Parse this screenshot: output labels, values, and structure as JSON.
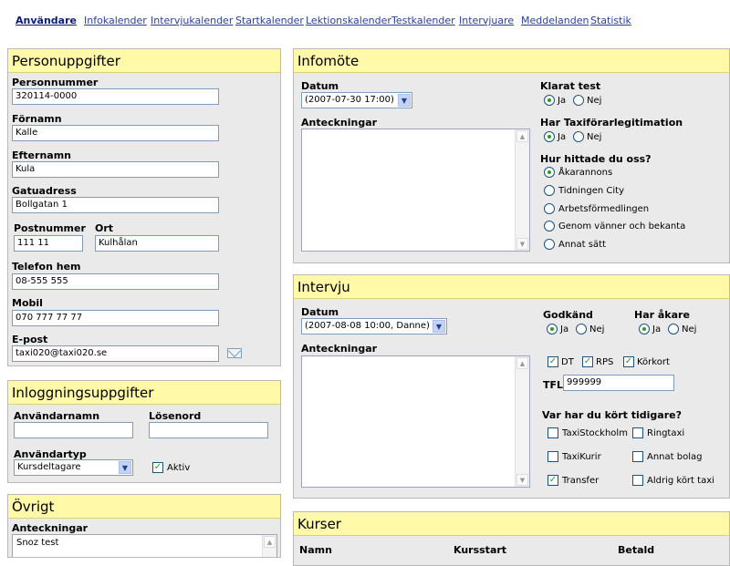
{
  "nav": [
    {
      "label": "Användare"
    },
    {
      "label": "Infokalender"
    },
    {
      "label": "Intervjukalender"
    },
    {
      "label": "Startkalender"
    },
    {
      "label": "Lektionskalender"
    },
    {
      "label": "Testkalender"
    },
    {
      "label": "Intervjuare"
    },
    {
      "label": "Meddelanden"
    },
    {
      "label": "Statistik"
    }
  ],
  "person": {
    "title": "Personuppgifter",
    "personnummer_label": "Personnummer",
    "personnummer": "320114-0000",
    "fornamn_label": "Förnamn",
    "fornamn": "Kalle",
    "efternamn_label": "Efternamn",
    "efternamn": "Kula",
    "gatuadress_label": "Gatuadress",
    "gatuadress": "Bollgatan 1",
    "postnummer_label": "Postnummer",
    "postnummer": "111 11",
    "ort_label": "Ort",
    "ort": "Kulhålan",
    "telefon_label": "Telefon hem",
    "telefon": "08-555 555",
    "mobil_label": "Mobil",
    "mobil": "070 777 77 77",
    "epost_label": "E-post",
    "epost": "taxi020@taxi020.se"
  },
  "login": {
    "title": "Inloggningsuppgifter",
    "username_label": "Användarnamn",
    "username": "",
    "password_label": "Lösenord",
    "password": "",
    "usertype_label": "Användartyp",
    "usertype": "Kursdeltagare",
    "active_label": "Aktiv"
  },
  "ovrigt": {
    "title": "Övrigt",
    "notes_label": "Anteckningar",
    "notes": "Snoz test"
  },
  "infomote": {
    "title": "Infomöte",
    "datum_label": "Datum",
    "datum": "(2007-07-30 17:00)",
    "notes_label": "Anteckningar",
    "notes": "",
    "klarat_label": "Klarat test",
    "ja": "Ja",
    "nej": "Nej",
    "legit_label": "Har Taxiförarlegitimation",
    "hittade_label": "Hur hittade du oss?",
    "hittade_options": [
      "Åkarannons",
      "Tidningen City",
      "Arbetsförmedlingen",
      "Genom vänner och bekanta",
      "Annat sätt"
    ]
  },
  "intervju": {
    "title": "Intervju",
    "datum_label": "Datum",
    "datum": "(2007-08-08 10:00, Danne)",
    "notes_label": "Anteckningar",
    "notes": "",
    "godkand_label": "Godkänd",
    "akare_label": "Har åkare",
    "ja": "Ja",
    "nej": "Nej",
    "dt": "DT",
    "rps": "RPS",
    "korkort": "Körkort",
    "tfl_label": "TFL",
    "tfl": "999999",
    "kort_label": "Var har du kört tidigare?",
    "kort_options": [
      "TaxiStockholm",
      "Ringtaxi",
      "TaxiKurir",
      "Annat bolag",
      "Transfer",
      "Aldrig kört taxi"
    ]
  },
  "kurser": {
    "title": "Kurser",
    "col_namn": "Namn",
    "col_kursstart": "Kursstart",
    "col_betald": "Betald"
  }
}
